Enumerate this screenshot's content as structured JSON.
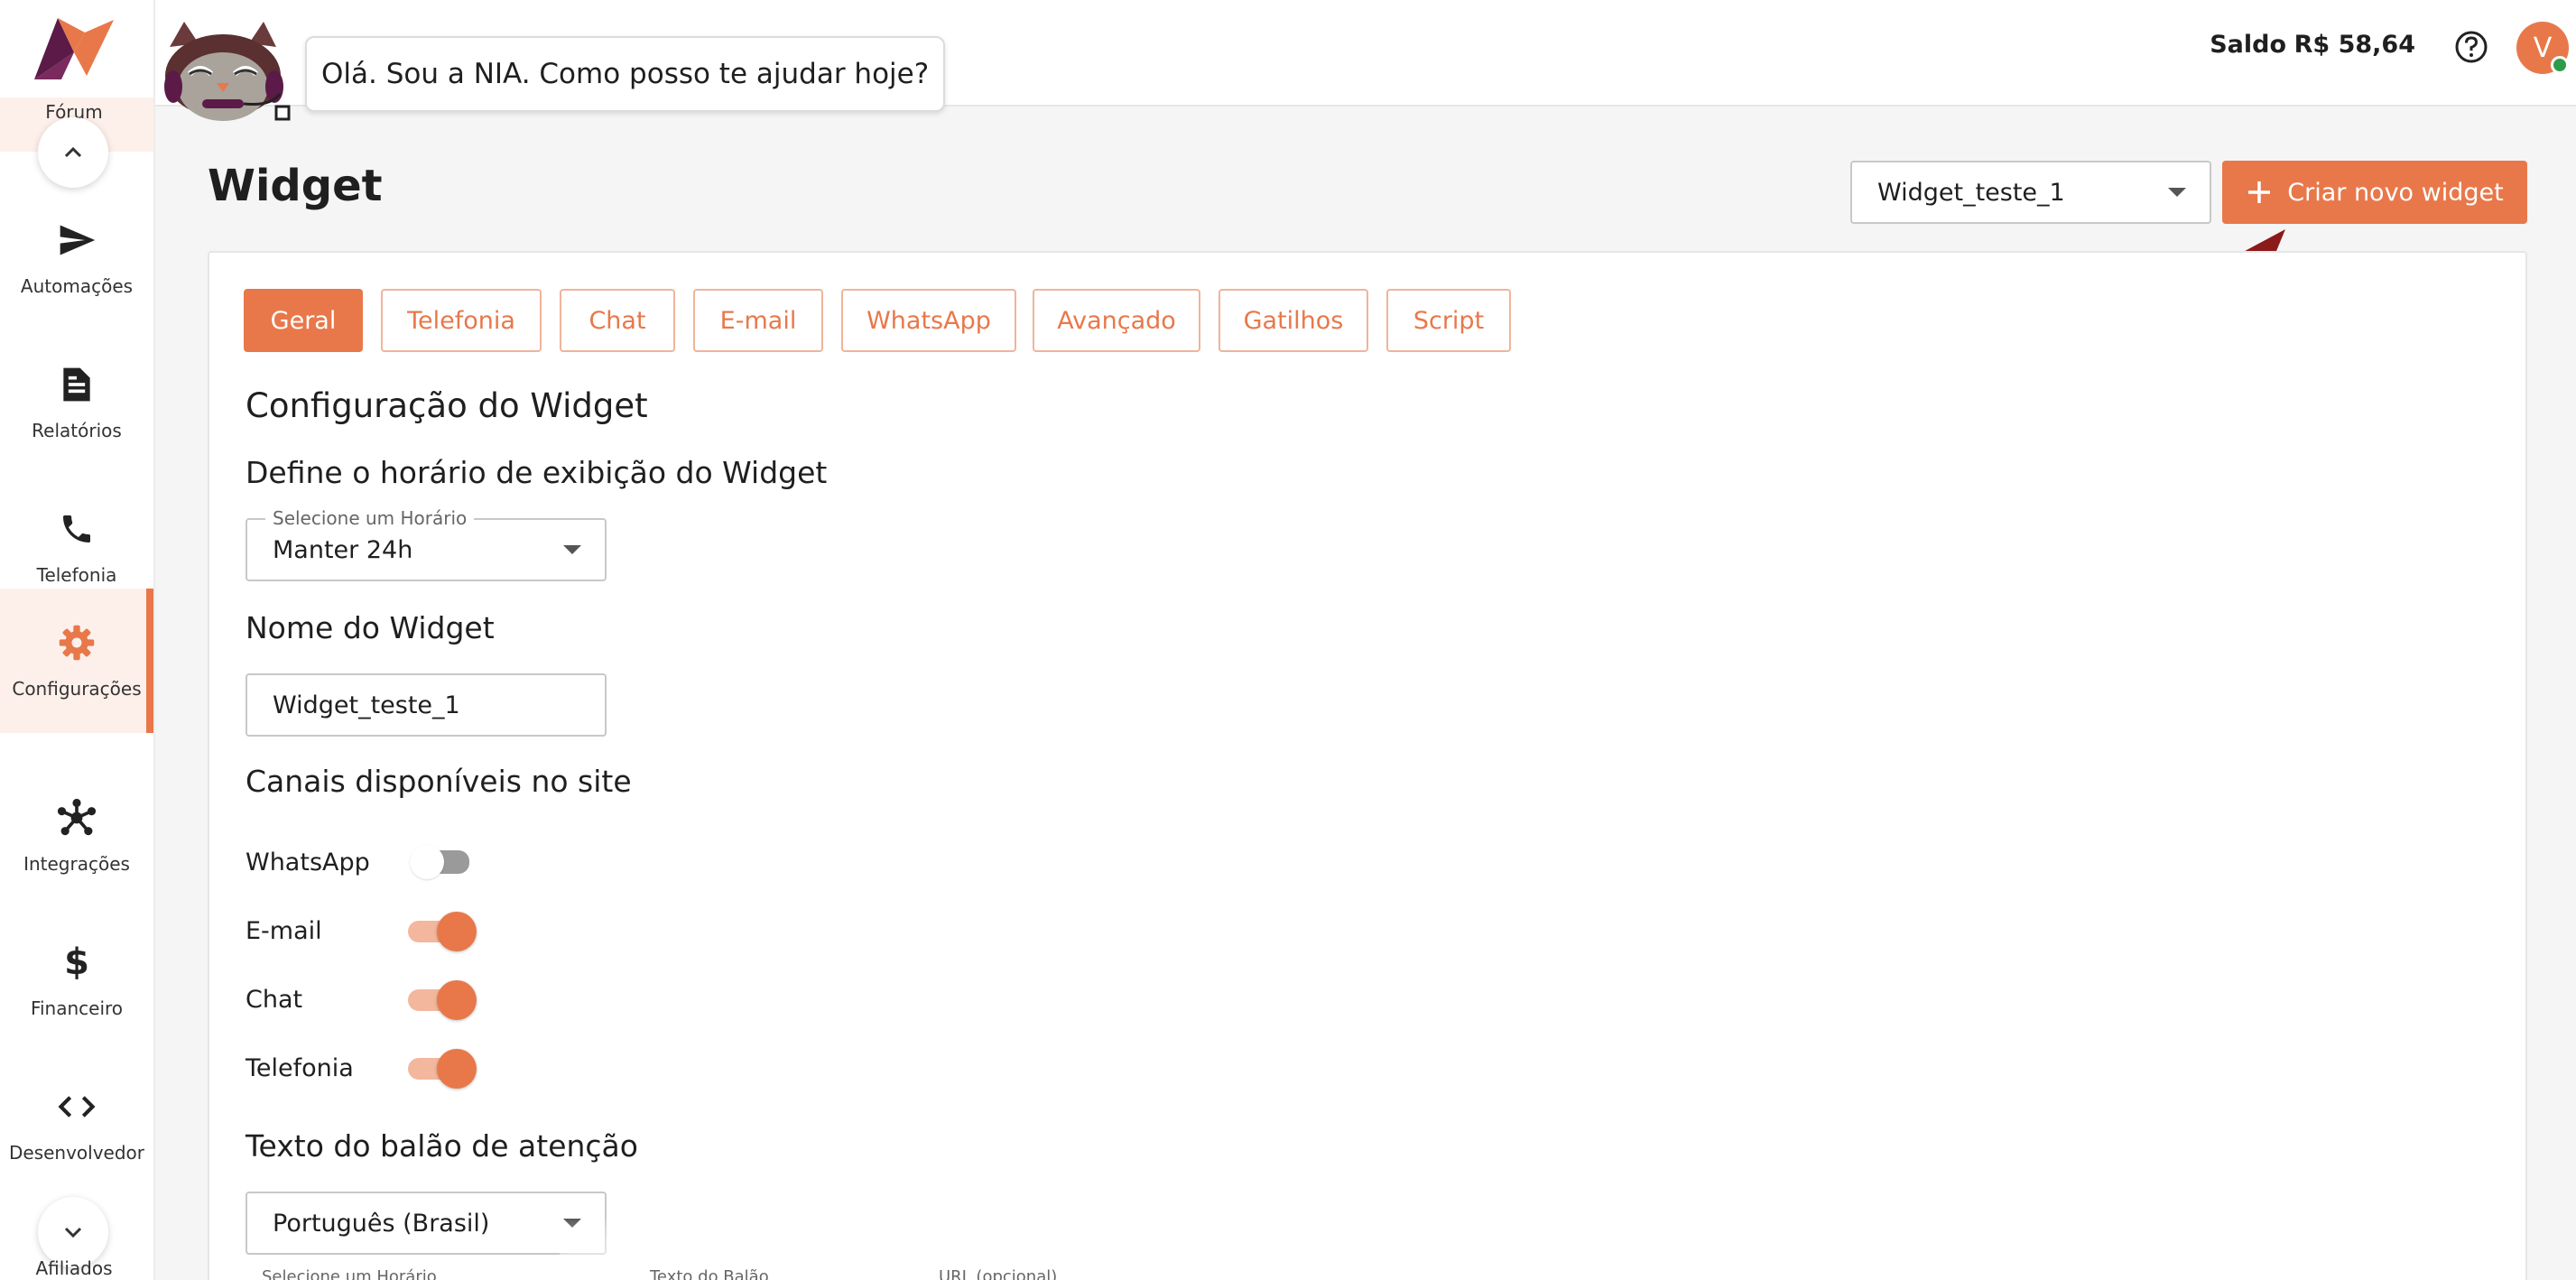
{
  "colors": {
    "accent": "#e8784a",
    "accent_light": "#f3b79d",
    "arrow": "#8b1a1a",
    "online": "#2e9b4a"
  },
  "sidebar": {
    "forum_label": "Fórum",
    "items": [
      {
        "label": "Automações",
        "icon": "send-icon",
        "active": false
      },
      {
        "label": "Relatórios",
        "icon": "document-icon",
        "active": false
      },
      {
        "label": "Telefonia",
        "icon": "phone-icon",
        "active": false
      },
      {
        "label": "Configurações",
        "icon": "gear-icon",
        "active": true
      },
      {
        "label": "Integrações",
        "icon": "network-icon",
        "active": false
      },
      {
        "label": "Financeiro",
        "icon": "dollar-icon",
        "active": false
      },
      {
        "label": "Desenvolvedor",
        "icon": "code-icon",
        "active": false
      }
    ],
    "afiliados_label": "Afiliados"
  },
  "header": {
    "assistant_message": "Olá. Sou a NIA. Como posso te ajudar hoje?",
    "balance_label": "Saldo",
    "balance_value": "R$ 58,64",
    "avatar_initial": "V"
  },
  "page": {
    "title": "Widget",
    "widget_select_value": "Widget_teste_1",
    "create_button_label": "Criar novo widget"
  },
  "tabs": [
    "Geral",
    "Telefonia",
    "Chat",
    "E-mail",
    "WhatsApp",
    "Avançado",
    "Gatilhos",
    "Script"
  ],
  "active_tab": "Geral",
  "form": {
    "section_title": "Configuração do Widget",
    "schedule_heading": "Define o horário de exibição do Widget",
    "schedule_select_label": "Selecione um Horário",
    "schedule_select_value": "Manter 24h",
    "name_heading": "Nome do Widget",
    "name_value": "Widget_teste_1",
    "channels_heading": "Canais disponíveis no site",
    "channels": [
      {
        "label": "WhatsApp",
        "enabled": false
      },
      {
        "label": "E-mail",
        "enabled": true
      },
      {
        "label": "Chat",
        "enabled": true
      },
      {
        "label": "Telefonia",
        "enabled": true
      }
    ],
    "balloon_heading": "Texto do balão de atenção",
    "language_value": "Português (Brasil)",
    "cutoff_labels": [
      "Selecione um Horário",
      "Texto do Balão",
      "URL (opcional)"
    ]
  }
}
